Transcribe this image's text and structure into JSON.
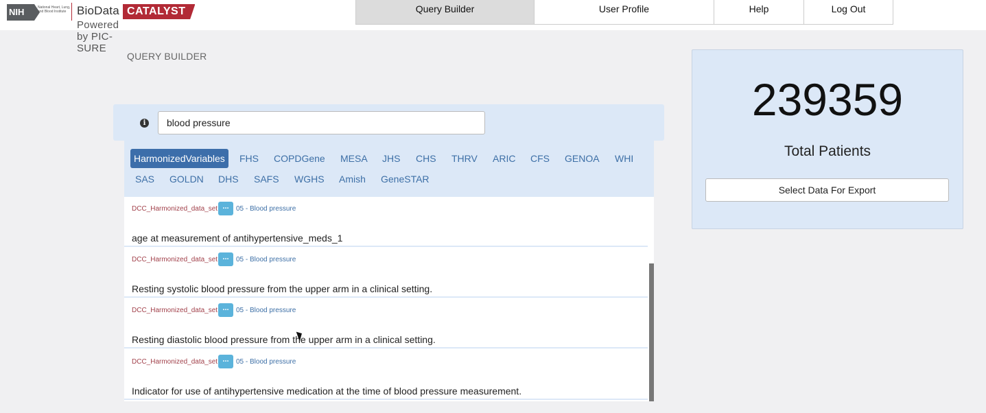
{
  "header": {
    "logo": {
      "nih_mark": "NIH",
      "nih_text": "National Heart, Lung, and Blood Institute",
      "bio": "BioData",
      "catalyst": "CATALYST",
      "powered": "Powered by PIC-SURE"
    },
    "nav": [
      {
        "label": "Query Builder",
        "active": true
      },
      {
        "label": "User Profile",
        "active": false
      },
      {
        "label": "Help",
        "active": false
      },
      {
        "label": "Log Out",
        "active": false
      }
    ]
  },
  "page": {
    "title": "QUERY BUILDER"
  },
  "search": {
    "info_icon": "info-icon",
    "value": "blood pressure",
    "placeholder": ""
  },
  "study_tabs": [
    {
      "label": "HarmonizedVariables",
      "active": true
    },
    {
      "label": "FHS"
    },
    {
      "label": "COPDGene"
    },
    {
      "label": "MESA"
    },
    {
      "label": "JHS"
    },
    {
      "label": "CHS"
    },
    {
      "label": "THRV"
    },
    {
      "label": "ARIC"
    },
    {
      "label": "CFS"
    },
    {
      "label": "GENOA"
    },
    {
      "label": "WHI"
    },
    {
      "label": "SAS"
    },
    {
      "label": "GOLDN"
    },
    {
      "label": "DHS"
    },
    {
      "label": "SAFS"
    },
    {
      "label": "WGHS"
    },
    {
      "label": "Amish"
    },
    {
      "label": "GeneSTAR"
    }
  ],
  "results": [
    {
      "dataset": "DCC_Harmonized_data_set",
      "more": "...",
      "category": "05 - Blood pressure",
      "description": "age at measurement of antihypertensive_meds_1"
    },
    {
      "dataset": "DCC_Harmonized_data_set",
      "more": "...",
      "category": "05 - Blood pressure",
      "description": "Resting systolic blood pressure from the upper arm in a clinical setting."
    },
    {
      "dataset": "DCC_Harmonized_data_set",
      "more": "...",
      "category": "05 - Blood pressure",
      "description": "Resting diastolic blood pressure from the upper arm in a clinical setting."
    },
    {
      "dataset": "DCC_Harmonized_data_set",
      "more": "...",
      "category": "05 - Blood pressure",
      "description": "Indicator for use of antihypertensive medication at the time of blood pressure measurement."
    }
  ],
  "count_panel": {
    "count": "239359",
    "label": "Total Patients",
    "export_label": "Select Data For Export"
  },
  "colors": {
    "accent": "#3c6eaa",
    "panel": "#dce8f7",
    "brand_red": "#b22a36",
    "more_button": "#5bb3db"
  }
}
